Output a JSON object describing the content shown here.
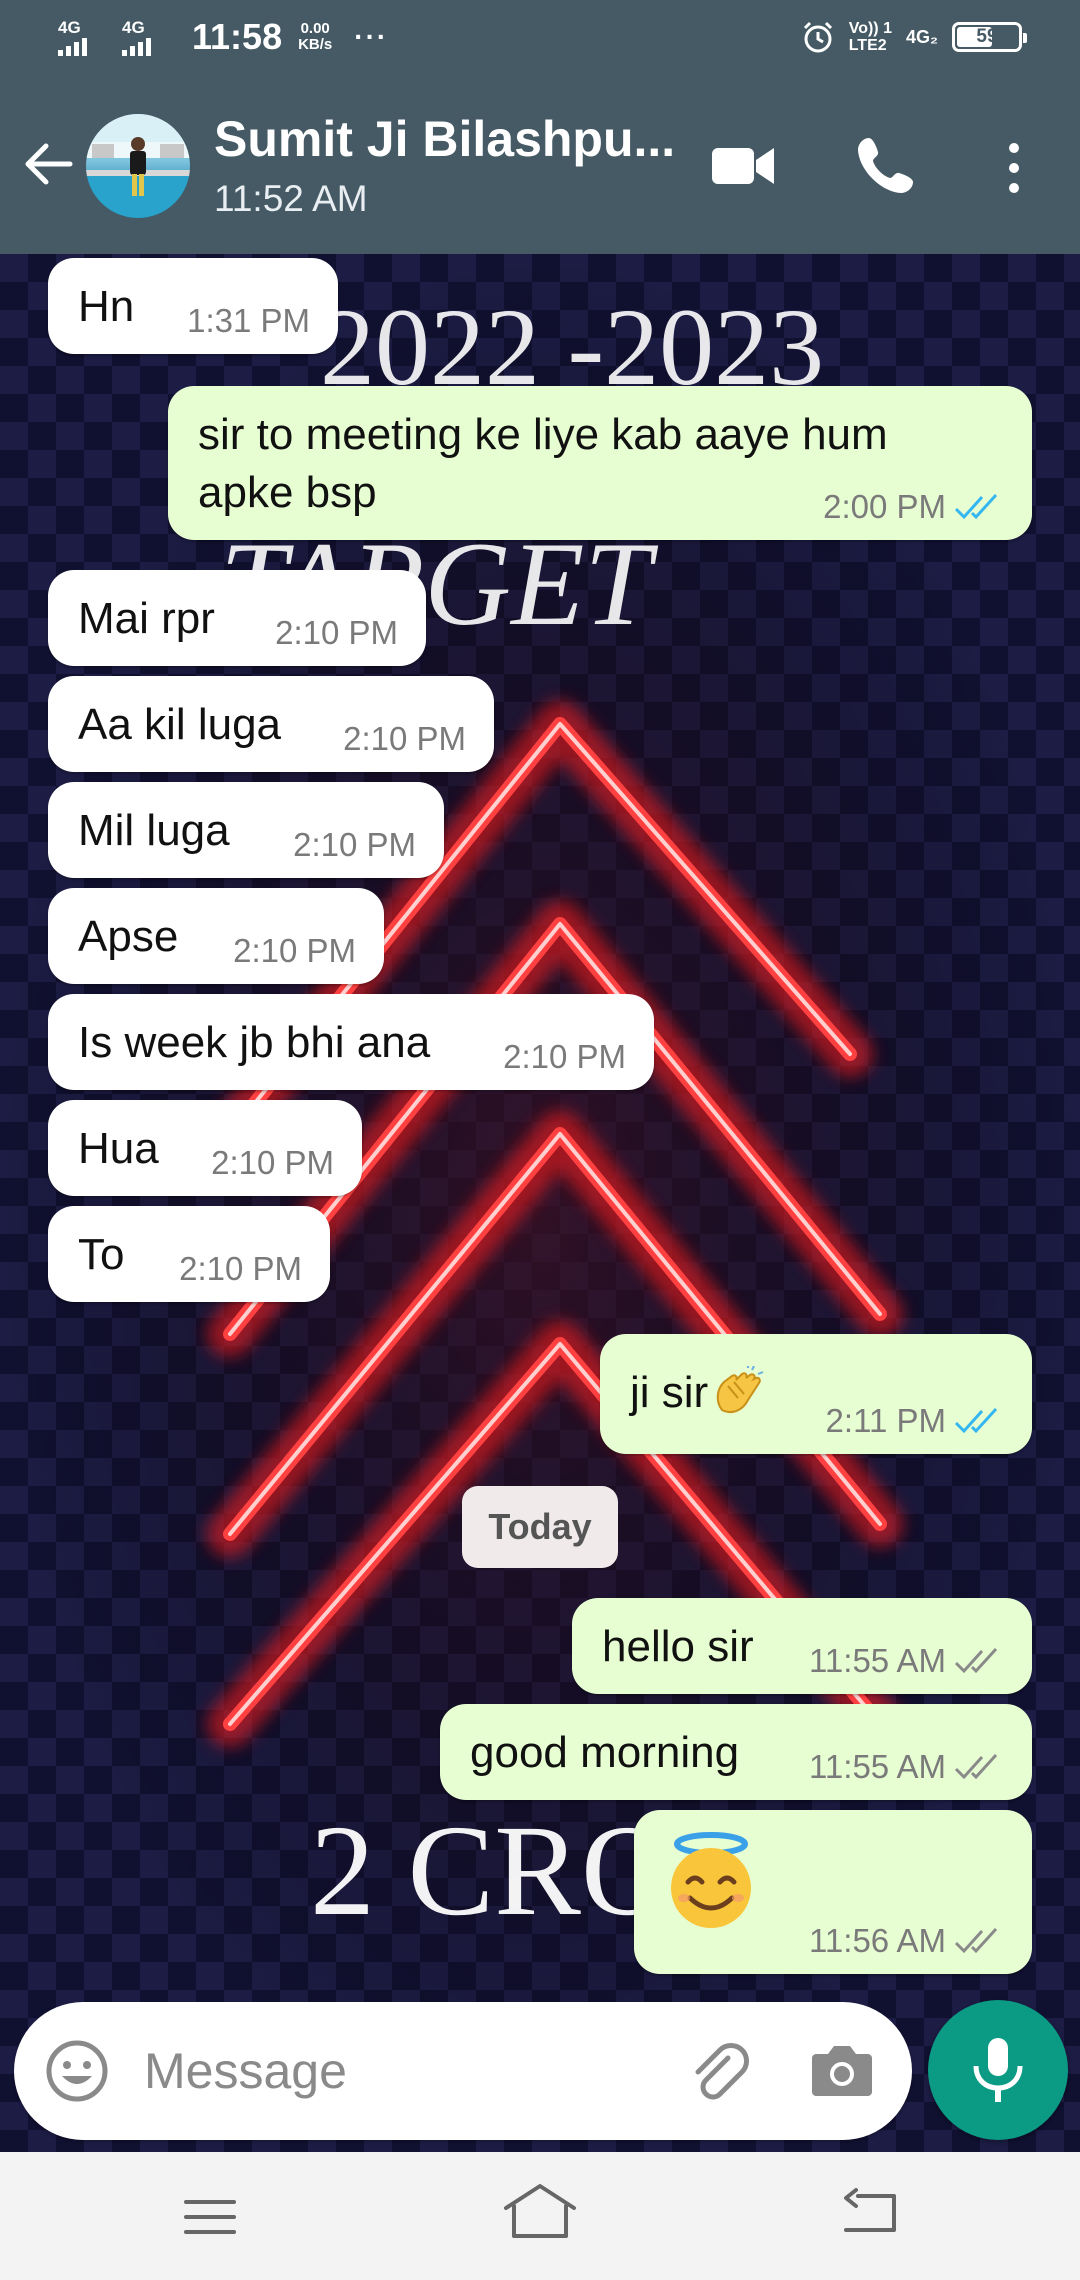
{
  "status_bar": {
    "net1": "4G",
    "net2": "4G",
    "time": "11:58",
    "speed_value": "0.00",
    "speed_unit": "KB/s",
    "more": "···",
    "volte_line1": "Vo)) 1",
    "volte_line2": "LTE2",
    "net3": "4G₂",
    "battery": "59",
    "battery_level": 0.59,
    "icon_color": "#ffffff",
    "background": "#455a64"
  },
  "header": {
    "contact_name": "Sumit Ji Bilashpu...",
    "last_seen": "11:52 AM",
    "icons": [
      "back-arrow-icon",
      "avatar",
      "video-call-icon",
      "phone-icon",
      "more-vert-icon"
    ]
  },
  "messages": [
    {
      "dir": "in",
      "text": "Hn",
      "time": "1:31 PM"
    },
    {
      "dir": "out",
      "text": "sir to meeting ke liye kab aaye hum",
      "text2": "apke bsp",
      "time": "2:00 PM",
      "status": "read"
    },
    {
      "dir": "in",
      "text": "Mai rpr",
      "time": "2:10 PM"
    },
    {
      "dir": "in",
      "text": "Aa kil luga",
      "time": "2:10 PM"
    },
    {
      "dir": "in",
      "text": "Mil luga",
      "time": "2:10 PM"
    },
    {
      "dir": "in",
      "text": "Apse",
      "time": "2:10 PM"
    },
    {
      "dir": "in",
      "text": "Is week jb bhi ana",
      "time": "2:10 PM"
    },
    {
      "dir": "in",
      "text": "Hua",
      "time": "2:10 PM"
    },
    {
      "dir": "in",
      "text": "To",
      "time": "2:10 PM"
    },
    {
      "dir": "out",
      "text": "ji sir",
      "emoji": "clapping-hands",
      "time": "2:11 PM",
      "status": "read"
    },
    {
      "dir": "out",
      "text": "hello sir",
      "time": "11:55 AM",
      "status": "delivered"
    },
    {
      "dir": "out",
      "text": "good morning",
      "time": "11:55 AM",
      "status": "delivered"
    },
    {
      "dir": "out",
      "text": "",
      "emoji": "smiling-face-with-halo",
      "time": "11:56 AM",
      "status": "delivered"
    }
  ],
  "date_divider": "Today",
  "composer": {
    "placeholder": "Message",
    "icons": [
      "emoji-icon",
      "attach-icon",
      "camera-icon",
      "mic-icon"
    ]
  },
  "colors": {
    "header": "#455a64",
    "incoming_bubble": "#ffffff",
    "outgoing_bubble": "#e7fed2",
    "read_tick": "#34b7f1",
    "delivered_tick": "#8a8a8a",
    "mic_button": "#0b9a83"
  },
  "nav_bar": {
    "icons": [
      "menu-lines-icon",
      "home-icon",
      "back-icon"
    ]
  }
}
